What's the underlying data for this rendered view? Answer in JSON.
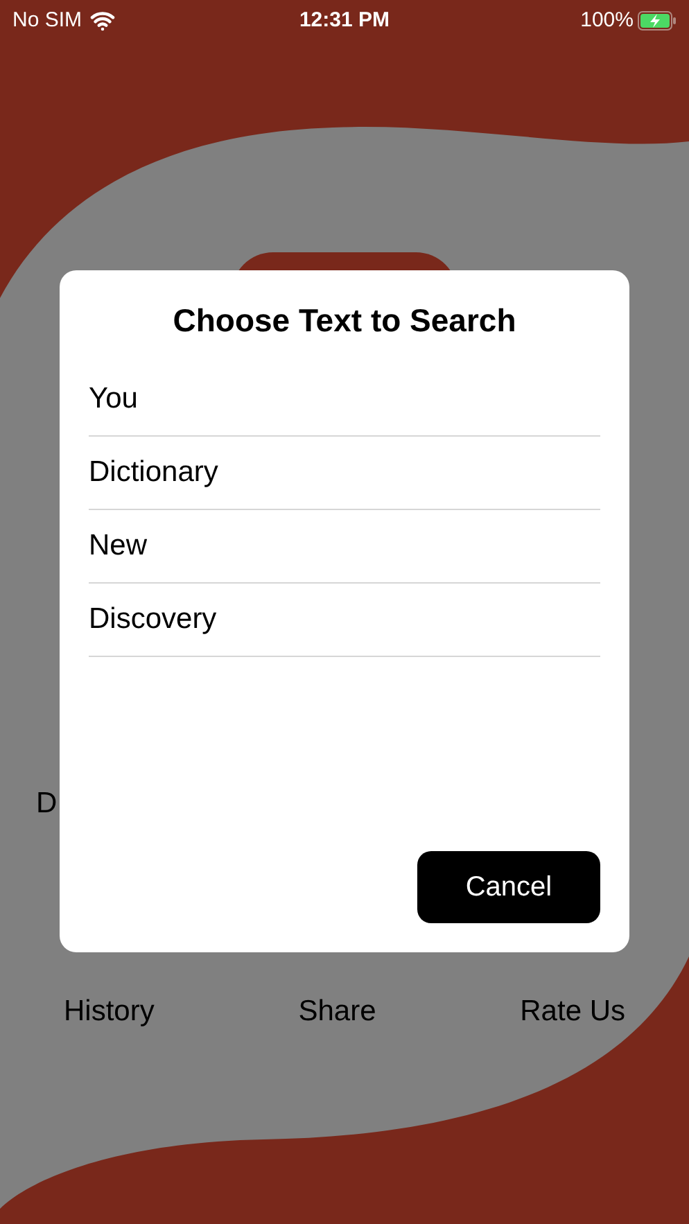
{
  "status_bar": {
    "carrier": "No SIM",
    "time": "12:31 PM",
    "battery": "100%"
  },
  "background": {
    "partial_label": "D",
    "menu": [
      "History",
      "Share",
      "Rate Us"
    ]
  },
  "dialog": {
    "title": "Choose Text to Search",
    "options": [
      "You",
      "Dictionary",
      "New",
      "Discovery"
    ],
    "cancel": "Cancel"
  }
}
